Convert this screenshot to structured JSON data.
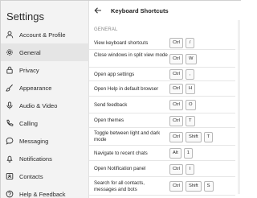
{
  "sidebar": {
    "title": "Settings",
    "items": [
      {
        "label": "Account & Profile",
        "icon": "user-icon",
        "active": false
      },
      {
        "label": "General",
        "icon": "gear-icon",
        "active": true
      },
      {
        "label": "Privacy",
        "icon": "lock-icon",
        "active": false
      },
      {
        "label": "Appearance",
        "icon": "brush-icon",
        "active": false
      },
      {
        "label": "Audio & Video",
        "icon": "mic-icon",
        "active": false
      },
      {
        "label": "Calling",
        "icon": "phone-icon",
        "active": false
      },
      {
        "label": "Messaging",
        "icon": "chat-icon",
        "active": false
      },
      {
        "label": "Notifications",
        "icon": "bell-icon",
        "active": false
      },
      {
        "label": "Contacts",
        "icon": "contact-card-icon",
        "active": false
      },
      {
        "label": "Help & Feedback",
        "icon": "help-icon",
        "active": false
      }
    ]
  },
  "main": {
    "title": "Keyboard Shortcuts",
    "section": "GENERAL",
    "shortcuts": [
      {
        "desc": "View keyboard shortcuts",
        "keys": [
          "Ctrl",
          "/"
        ]
      },
      {
        "desc": "Close windows in split view mode",
        "keys": [
          "Ctrl",
          "W"
        ]
      },
      {
        "desc": "Open app settings",
        "keys": [
          "Ctrl",
          ","
        ]
      },
      {
        "desc": "Open Help in default browser",
        "keys": [
          "Ctrl",
          "H"
        ]
      },
      {
        "desc": "Send feedback",
        "keys": [
          "Ctrl",
          "O"
        ]
      },
      {
        "desc": "Open themes",
        "keys": [
          "Ctrl",
          "T"
        ]
      },
      {
        "desc": "Toggle between light and dark mode",
        "keys": [
          "Ctrl",
          "Shift",
          "T"
        ]
      },
      {
        "desc": "Navigate to recent chats",
        "keys": [
          "Alt",
          "1"
        ]
      },
      {
        "desc": "Open Notification panel",
        "keys": [
          "Ctrl",
          "I"
        ]
      },
      {
        "desc": "Search for all contacts, messages and bots",
        "keys": [
          "Ctrl",
          "Shift",
          "S"
        ]
      }
    ]
  }
}
